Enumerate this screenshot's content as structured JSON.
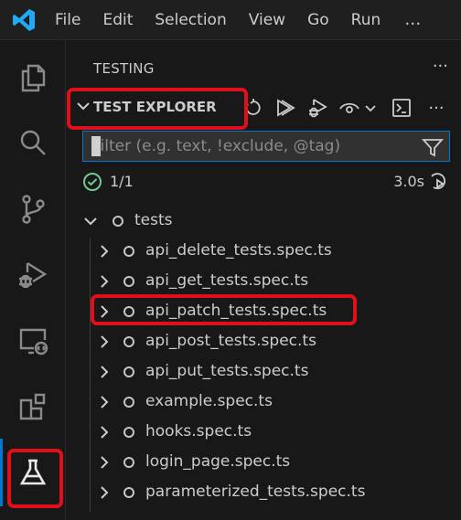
{
  "menubar": {
    "items": [
      "File",
      "Edit",
      "Selection",
      "View",
      "Go",
      "Run"
    ],
    "more": "…"
  },
  "activity_bar": {
    "items": [
      "explorer",
      "search",
      "source-control",
      "run-and-debug",
      "remote-explorer",
      "extensions",
      "testing"
    ],
    "active": "testing"
  },
  "panel": {
    "title": "TESTING",
    "more": "···",
    "section_title": "TEST EXPLORER",
    "filter_placeholder": "Filter (e.g. text, !exclude, @tag)",
    "summary_count": "1/1",
    "summary_duration": "3.0s"
  },
  "tree": {
    "root": "tests",
    "files": [
      "api_delete_tests.spec.ts",
      "api_get_tests.spec.ts",
      "api_patch_tests.spec.ts",
      "api_post_tests.spec.ts",
      "api_put_tests.spec.ts",
      "example.spec.ts",
      "hooks.spec.ts",
      "login_page.spec.ts",
      "parameterized_tests.spec.ts"
    ]
  },
  "colors": {
    "accent": "#0078d4",
    "highlight_box": "#e0101a",
    "pass": "#73c991",
    "logo": "#23a9f2"
  }
}
